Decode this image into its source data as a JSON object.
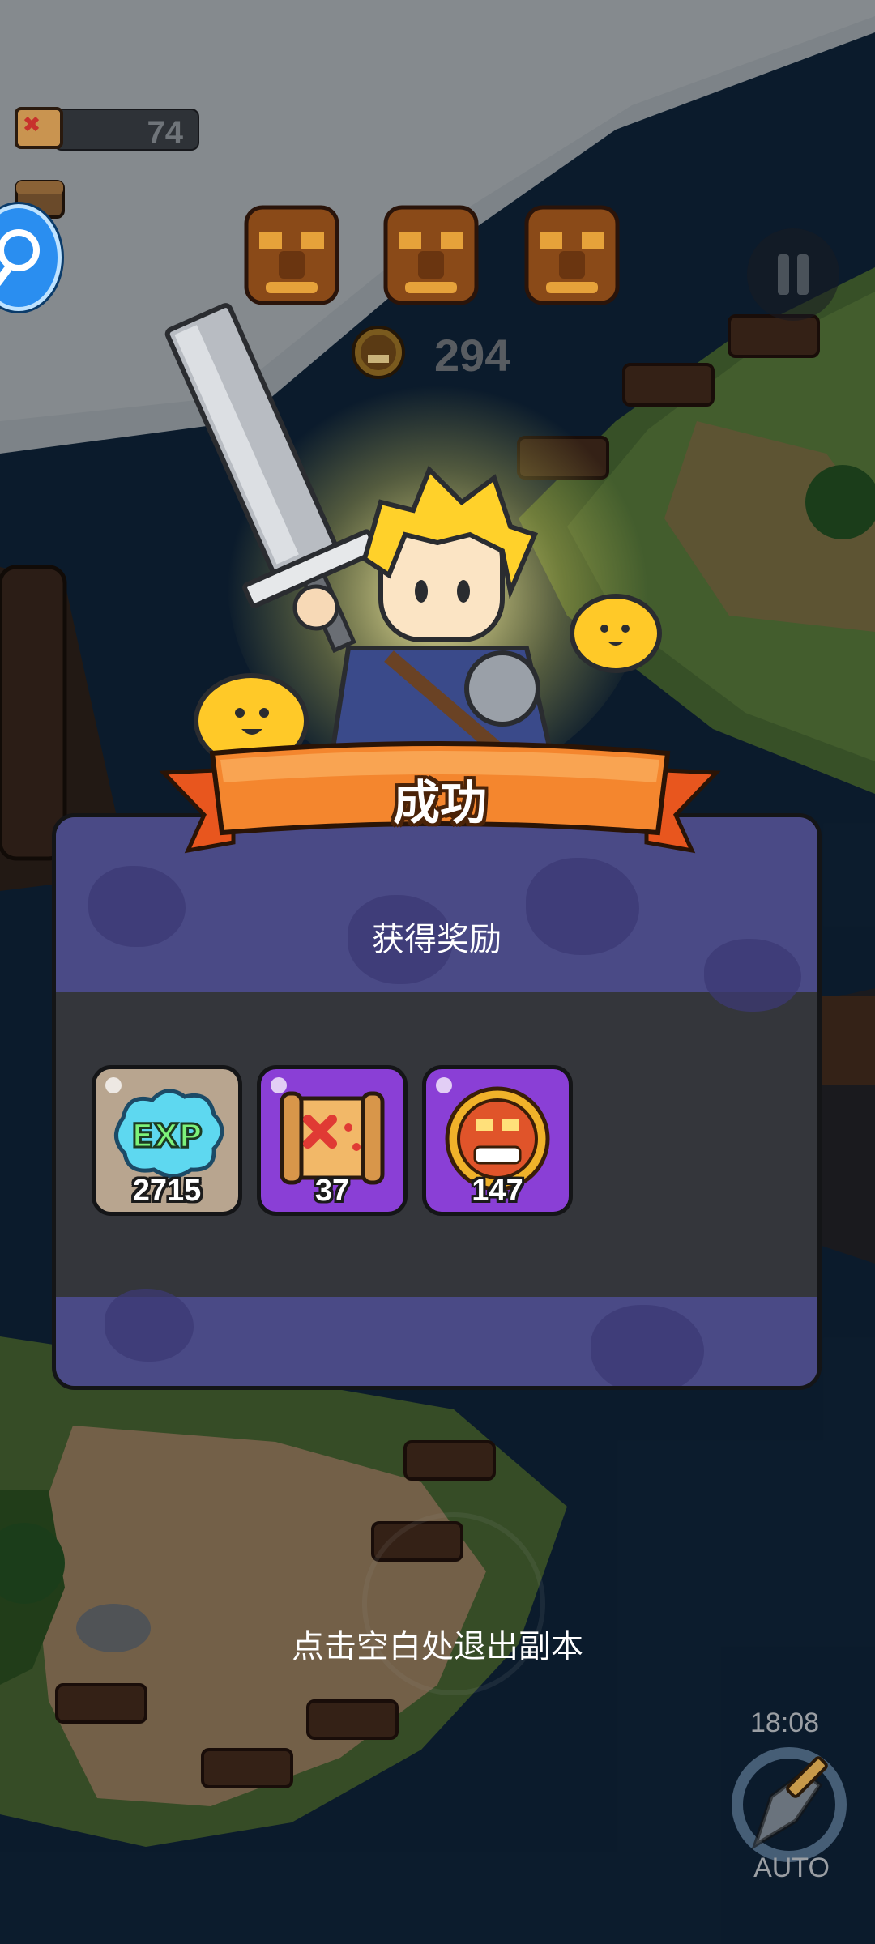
{
  "hud": {
    "scroll_count": "74",
    "coin_count": "294"
  },
  "result": {
    "title": "成功",
    "subtitle": "获得奖励",
    "rewards": [
      {
        "name": "exp",
        "icon": "exp-icon",
        "count": "2715",
        "bg": "#b8a58f"
      },
      {
        "name": "treasure-map",
        "icon": "treasure-map-icon",
        "count": "37",
        "bg": "#8a3fd6"
      },
      {
        "name": "tiki-coin",
        "icon": "tiki-coin-icon",
        "count": "147",
        "bg": "#8a3fd6"
      }
    ]
  },
  "exit_hint": "点击空白处退出副本",
  "clock": "18:08",
  "auto_label": "AUTO",
  "colors": {
    "panel_header": "#4a4a86",
    "panel_body": "#34363b",
    "banner": "#f07a2a",
    "accent_blue": "#2a8ef0"
  }
}
